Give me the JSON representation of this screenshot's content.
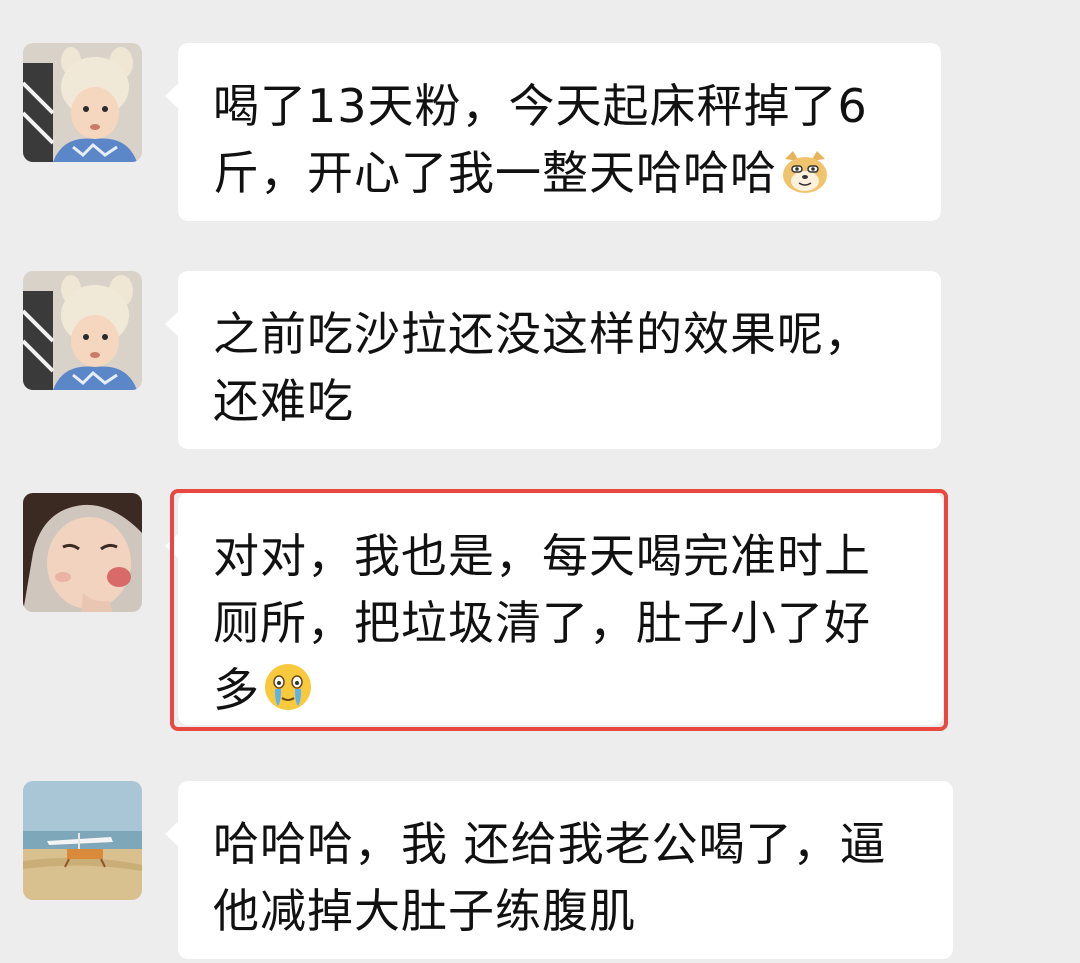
{
  "chat": {
    "messages": [
      {
        "avatar": "toddler-bunny-hat-avatar",
        "lines": [
          "喝了13天粉，今天起床秤掉了6",
          "斤，开心了我一整天哈哈哈"
        ],
        "emoji": "doge-emoji"
      },
      {
        "avatar": "toddler-bunny-hat-avatar",
        "lines": [
          "之前吃沙拉还没这样的效果呢，",
          "还难吃"
        ]
      },
      {
        "avatar": "girl-pouting-avatar",
        "lines": [
          "对对，我也是，每天喝完准时上",
          "厕所，把垃圾清了，肚子小了好",
          "多"
        ],
        "emoji": "crying-laughing-emoji",
        "highlighted": true
      },
      {
        "avatar": "beach-scene-avatar",
        "lines": [
          "哈哈哈，我 还给我老公喝了，逼",
          "他减掉大肚子练腹肌"
        ]
      }
    ]
  },
  "colors": {
    "background": "#ededed",
    "bubble": "#ffffff",
    "highlight_border": "#e8483f",
    "text": "#111111"
  }
}
